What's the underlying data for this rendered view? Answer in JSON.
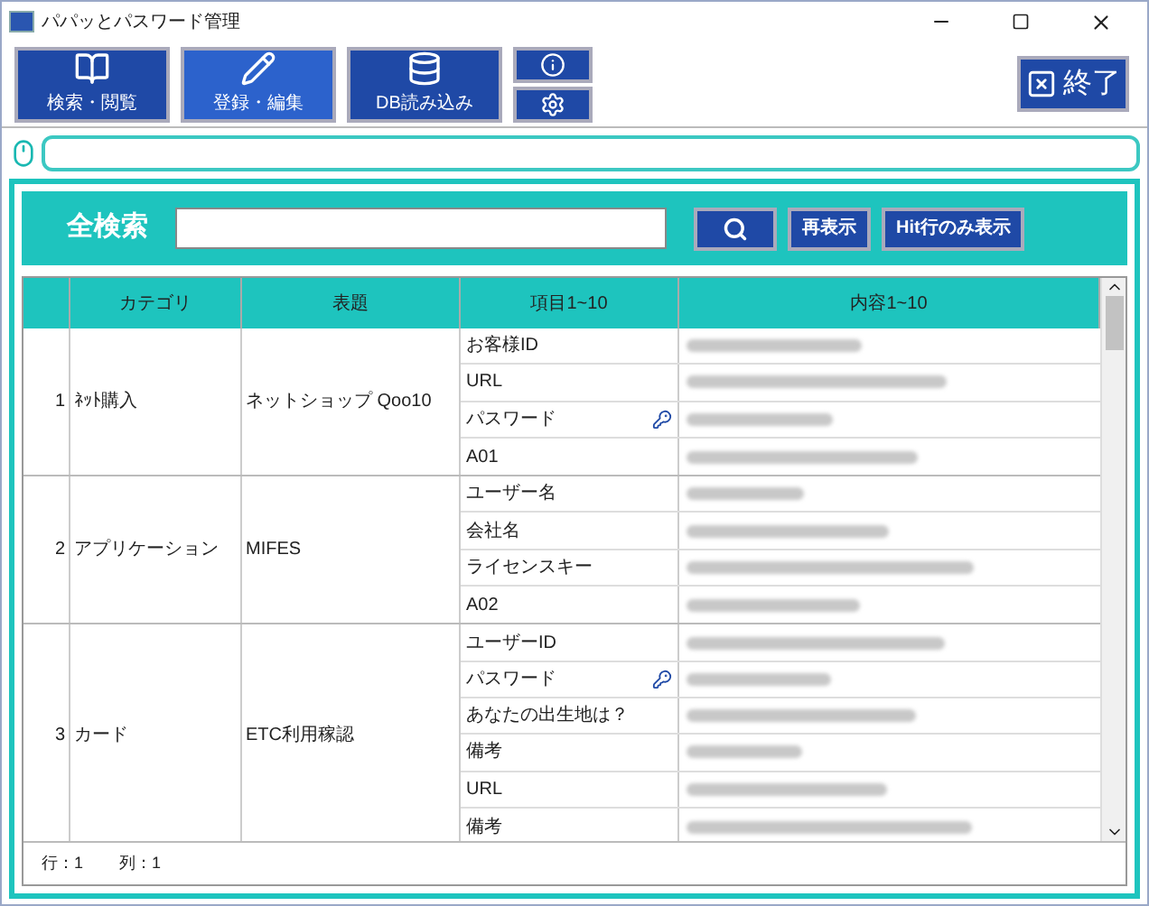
{
  "window": {
    "title": "パパッとパスワード管理"
  },
  "toolbar": [
    {
      "label": "検索・閲覧",
      "kind": "book",
      "selected": false
    },
    {
      "label": "登録・編集",
      "kind": "pencil",
      "selected": true
    },
    {
      "label": "DB読み込み",
      "kind": "database",
      "selected": false
    }
  ],
  "exit_button": {
    "label": "終了"
  },
  "search": {
    "label": "全検索",
    "buttons": [
      {
        "kind": "search"
      },
      {
        "kind": "text",
        "label": "再表示"
      },
      {
        "kind": "text",
        "label": "Hit行のみ表示"
      }
    ]
  },
  "table": {
    "columns": [
      "カテゴリ",
      "表題",
      "項目1~10",
      "内容1~10"
    ],
    "rows": [
      {
        "number": "1",
        "category": "ﾈｯﾄ購入",
        "title": "ネットショップ Qoo10",
        "items": [
          {
            "label": "お客様ID",
            "kind": "text"
          },
          {
            "label": "URL",
            "kind": "text"
          },
          {
            "label": "パスワード",
            "kind": "password"
          },
          {
            "label": "A01",
            "kind": "text"
          }
        ]
      },
      {
        "number": "2",
        "category": "アプリケーション",
        "title": "MIFES",
        "items": [
          {
            "label": "ユーザー名",
            "kind": "text"
          },
          {
            "label": "会社名",
            "kind": "text"
          },
          {
            "label": "ライセンスキー",
            "kind": "text"
          },
          {
            "label": "A02",
            "kind": "text"
          }
        ]
      },
      {
        "number": "3",
        "category": "カード",
        "title": "ETC利用稼認",
        "items": [
          {
            "label": "ユーザーID",
            "kind": "text"
          },
          {
            "label": "パスワード",
            "kind": "password"
          },
          {
            "label": "あなたの出生地は？",
            "kind": "text"
          },
          {
            "label": "備考",
            "kind": "text"
          },
          {
            "label": "URL",
            "kind": "text"
          },
          {
            "label": "備考",
            "kind": "text"
          }
        ]
      }
    ]
  },
  "status_bar": [
    "行：1",
    "列：1"
  ]
}
